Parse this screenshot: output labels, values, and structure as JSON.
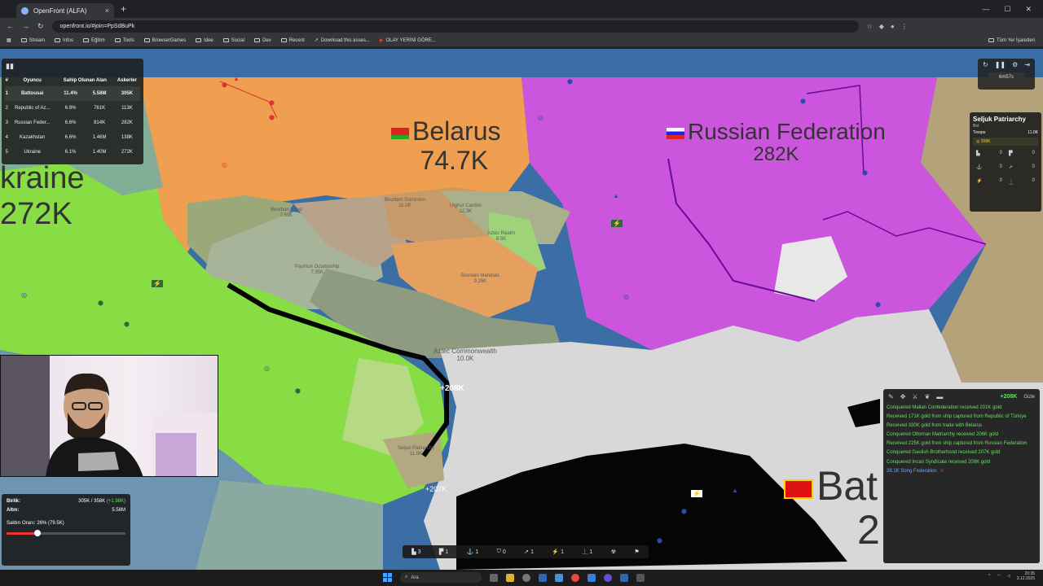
{
  "browser": {
    "tab_title": "OpenFront (ALFA)",
    "url": "openfront.io/#join=PpSdBuPk",
    "bookmarks": [
      "Stream",
      "Infos",
      "Eğitim",
      "Tools",
      "BrowserGames",
      "Idee",
      "Social",
      "Dev",
      "Recent",
      "Download this asses...",
      "OLAY YERİNİ GÖRE..."
    ],
    "bookmarks_right": "Tüm Yer İşaretleri"
  },
  "leaderboard": {
    "headers": [
      "#",
      "Oyuncu",
      "Sahip Olunan Alan",
      "Askerler"
    ],
    "rows": [
      {
        "rank": "1",
        "player": "Battousai",
        "owned": "11.4%",
        "gold": "5.58M",
        "troops": "305K"
      },
      {
        "rank": "2",
        "player": "Republic of Az...",
        "owned": "6.9%",
        "gold": "761K",
        "troops": "113K"
      },
      {
        "rank": "3",
        "player": "Russian Feder...",
        "owned": "6.6%",
        "gold": "814K",
        "troops": "282K"
      },
      {
        "rank": "4",
        "player": "Kazakhstan",
        "owned": "6.6%",
        "gold": "1.46M",
        "troops": "138K"
      },
      {
        "rank": "5",
        "player": "Ukraine",
        "owned": "6.1%",
        "gold": "1.40M",
        "troops": "272K"
      }
    ]
  },
  "timer": "6m57s",
  "player_card": {
    "name": "Seljuk Patriarchy",
    "type": "Bot",
    "troops_label": "Troops",
    "troops_value": "11.0K",
    "gold": "208K",
    "counts": [
      "0",
      "0",
      "0",
      "0",
      "0",
      "0"
    ]
  },
  "map_labels": {
    "belarus_name": "Belarus",
    "belarus_troops": "74.7K",
    "russia_name": "Russian Federation",
    "russia_troops": "282K",
    "ukraine_name": "kraine",
    "ukraine_troops": "272K",
    "player_name": "Bat",
    "player_troops": "2",
    "attack_1": "+208K",
    "attack_2": "+207K",
    "regions": [
      {
        "name": "Bourbon Hood",
        "value": "7.69K"
      },
      {
        "name": "Pashtun Octatorship",
        "value": "7.35K"
      },
      {
        "name": "Bourbon Dominion",
        "value": "11.3K"
      },
      {
        "name": "Uighur Canton",
        "value": "12.3K"
      },
      {
        "name": "Aztec Realm",
        "value": "8.5K"
      },
      {
        "name": "Bosnian Mandate",
        "value": "9.26K"
      },
      {
        "name": "Aztec Commonwealth",
        "value": "10.0K"
      },
      {
        "name": "Seljuk Patriarchy",
        "value": "11.0K"
      }
    ]
  },
  "stats": {
    "units_label": "Birlik:",
    "units_value": "305K / 358K",
    "units_gain": "(+1.98K)",
    "gold_label": "Altın:",
    "gold_value": "5.58M",
    "attack_rate_label": "Saldırı Oranı: 26% (79.5K)",
    "attack_rate_fraction": 0.26
  },
  "build_bar": [
    "3",
    "1",
    "1",
    "0",
    "1",
    "1",
    "1"
  ],
  "events": {
    "gain": "+208K",
    "hide_label": "Gizle",
    "items": [
      {
        "text": "Conquered Malian Confederation received 201K gold",
        "color": "green"
      },
      {
        "text": "Received 171K gold from ship captured from Republic of Türkiye",
        "color": "green"
      },
      {
        "text": "Received 330K gold from trade with Belarus",
        "color": "green"
      },
      {
        "text": "Conquered Ottoman Matriarchy received 206K gold",
        "color": "green"
      },
      {
        "text": "Received 225K gold from ship captured from Russian Federation",
        "color": "green"
      },
      {
        "text": "Conquered Gaulish Brotherhood received 207K gold",
        "color": "green"
      },
      {
        "text": "Conquered Incan Syndicate received 208K gold",
        "color": "green"
      },
      {
        "text": "38.1K Song Federation",
        "color": "blue"
      }
    ]
  },
  "taskbar": {
    "search": "Ara",
    "time": "20:35",
    "date": "3.12.2025"
  },
  "colors": {
    "belarus": "#ef9f4f",
    "russia": "#cc55dd",
    "ukraine": "#88dd44",
    "player": "#d8d8d8",
    "sea": "#3b6ea5"
  }
}
